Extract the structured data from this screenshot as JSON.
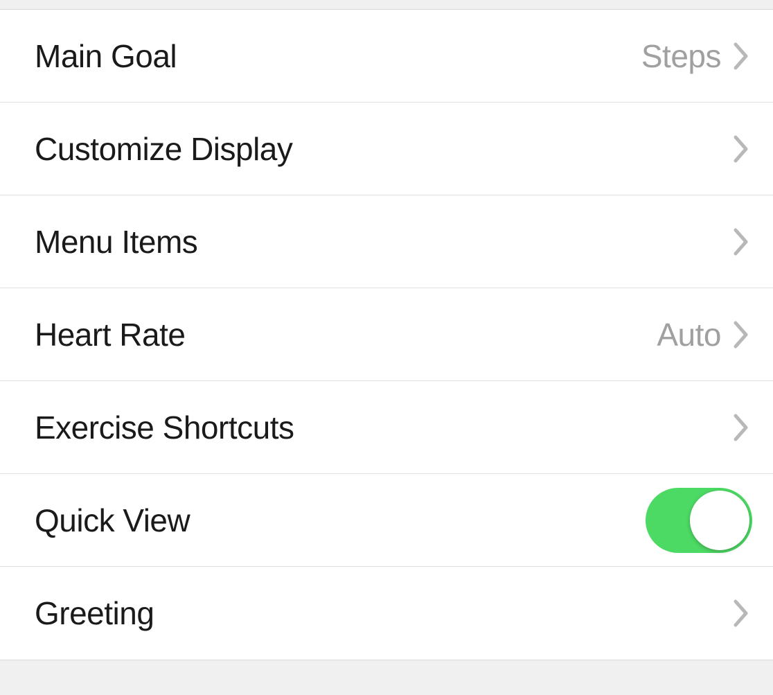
{
  "settings": {
    "items": [
      {
        "label": "Main Goal",
        "value": "Steps",
        "type": "nav"
      },
      {
        "label": "Customize Display",
        "value": "",
        "type": "nav"
      },
      {
        "label": "Menu Items",
        "value": "",
        "type": "nav"
      },
      {
        "label": "Heart Rate",
        "value": "Auto",
        "type": "nav"
      },
      {
        "label": "Exercise Shortcuts",
        "value": "",
        "type": "nav"
      },
      {
        "label": "Quick View",
        "value": "",
        "type": "toggle",
        "on": true
      },
      {
        "label": "Greeting",
        "value": "",
        "type": "nav"
      }
    ]
  }
}
